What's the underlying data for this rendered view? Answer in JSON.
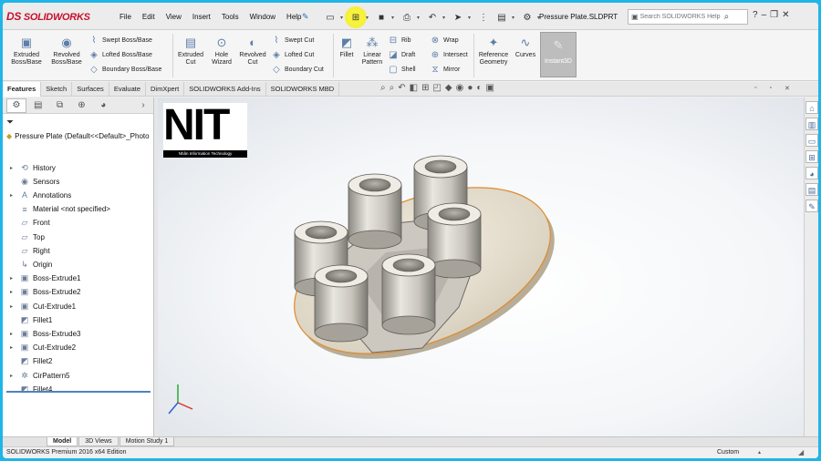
{
  "app": {
    "logo_prefix": "DS",
    "logo_text": "SOLIDWORKS",
    "doc_title": "Pressure Plate.SLDPRT"
  },
  "menu": [
    "File",
    "Edit",
    "View",
    "Insert",
    "Tools",
    "Window",
    "Help"
  ],
  "search": {
    "placeholder": "Search SOLIDWORKS Help"
  },
  "window_controls": {
    "help": "?",
    "minimize": "–",
    "restore": "❐",
    "close": "✕"
  },
  "ribbon": {
    "extruded_boss": "Extruded Boss/Base",
    "revolved_boss": "Revolved Boss/Base",
    "swept_boss": "Swept Boss/Base",
    "lofted_boss": "Lofted Boss/Base",
    "boundary_boss": "Boundary Boss/Base",
    "extruded_cut": "Extruded Cut",
    "hole_wizard": "Hole Wizard",
    "revolved_cut": "Revolved Cut",
    "swept_cut": "Swept Cut",
    "lofted_cut": "Lofted Cut",
    "boundary_cut": "Boundary Cut",
    "fillet": "Fillet",
    "linear_pattern": "Linear Pattern",
    "rib": "Rib",
    "draft": "Draft",
    "shell": "Shell",
    "wrap": "Wrap",
    "intersect": "Intersect",
    "mirror": "Mirror",
    "reference_geometry": "Reference Geometry",
    "curves": "Curves",
    "instant3d": "Instant3D"
  },
  "tabs": [
    "Features",
    "Sketch",
    "Surfaces",
    "Evaluate",
    "DimXpert",
    "SOLIDWORKS Add-Ins",
    "SOLIDWORKS MBD"
  ],
  "tree": {
    "root": "Pressure Plate  (Default<<Default>_Photo",
    "items": [
      {
        "label": "History",
        "icon": "history-icon",
        "glyph": "⟲",
        "expand": true
      },
      {
        "label": "Sensors",
        "icon": "sensor-icon",
        "glyph": "◉",
        "expand": false
      },
      {
        "label": "Annotations",
        "icon": "annotation-icon",
        "glyph": "A",
        "expand": true
      },
      {
        "label": "Material <not specified>",
        "icon": "material-icon",
        "glyph": "≡",
        "expand": false
      },
      {
        "label": "Front",
        "icon": "plane-icon",
        "glyph": "▱",
        "expand": false
      },
      {
        "label": "Top",
        "icon": "plane-icon",
        "glyph": "▱",
        "expand": false
      },
      {
        "label": "Right",
        "icon": "plane-icon",
        "glyph": "▱",
        "expand": false
      },
      {
        "label": "Origin",
        "icon": "origin-icon",
        "glyph": "↳",
        "expand": false
      },
      {
        "label": "Boss-Extrude1",
        "icon": "extrude-icon",
        "glyph": "▣",
        "expand": true
      },
      {
        "label": "Boss-Extrude2",
        "icon": "extrude-icon",
        "glyph": "▣",
        "expand": true
      },
      {
        "label": "Cut-Extrude1",
        "icon": "cut-icon",
        "glyph": "▣",
        "expand": true
      },
      {
        "label": "Fillet1",
        "icon": "fillet-icon",
        "glyph": "◩",
        "expand": false
      },
      {
        "label": "Boss-Extrude3",
        "icon": "extrude-icon",
        "glyph": "▣",
        "expand": true
      },
      {
        "label": "Cut-Extrude2",
        "icon": "cut-icon",
        "glyph": "▣",
        "expand": true
      },
      {
        "label": "Fillet2",
        "icon": "fillet-icon",
        "glyph": "◩",
        "expand": false
      },
      {
        "label": "CirPattern5",
        "icon": "circular-pattern-icon",
        "glyph": "✲",
        "expand": true
      },
      {
        "label": "Fillet4",
        "icon": "fillet-icon",
        "glyph": "◩",
        "expand": false
      }
    ]
  },
  "watermark": {
    "big": "NIT",
    "small": "Nhân Information Technology"
  },
  "bottom_tabs": [
    "Model",
    "3D Views",
    "Motion Study 1"
  ],
  "status": {
    "edition": "SOLIDWORKS Premium 2016 x64 Edition",
    "units": "Custom"
  }
}
